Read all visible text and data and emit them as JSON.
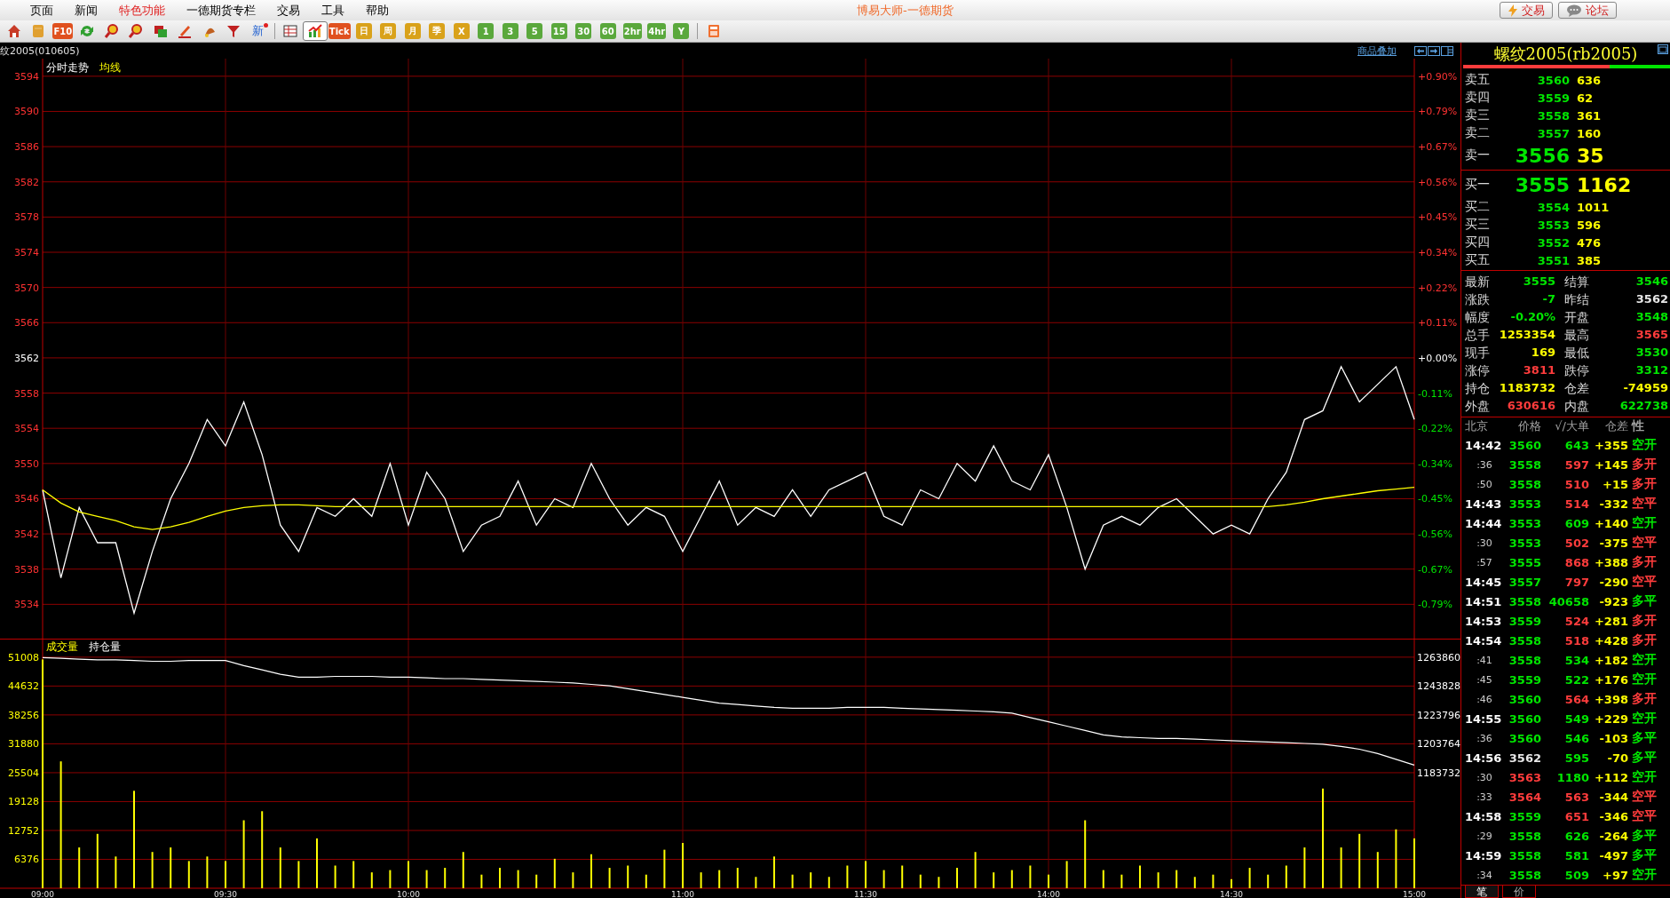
{
  "menu": [
    {
      "label": "页面",
      "highlighted": false
    },
    {
      "label": "新闻",
      "highlighted": false
    },
    {
      "label": "特色功能",
      "highlighted": true
    },
    {
      "label": "一德期货专栏",
      "highlighted": false
    },
    {
      "label": "交易",
      "highlighted": false
    },
    {
      "label": "工具",
      "highlighted": false
    },
    {
      "label": "帮助",
      "highlighted": false
    }
  ],
  "window_title": "博易大师-一德期货",
  "top_buttons": [
    {
      "kind": "lightning",
      "label": "交易"
    },
    {
      "kind": "speech",
      "label": "论坛"
    }
  ],
  "toolbar": [
    {
      "kind": "icon",
      "selected": false
    },
    {
      "kind": "icon",
      "selected": false
    },
    {
      "kind": "badge",
      "label": "F10",
      "color": "#e0501e",
      "selected": false
    },
    {
      "kind": "icon",
      "selected": false
    },
    {
      "kind": "icon",
      "selected": false
    },
    {
      "kind": "icon",
      "selected": false
    },
    {
      "kind": "icon",
      "selected": false
    },
    {
      "kind": "icon",
      "selected": false
    },
    {
      "kind": "icon",
      "selected": false
    },
    {
      "kind": "icon",
      "selected": false
    },
    {
      "kind": "text",
      "label": "新",
      "selected": false
    },
    {
      "kind": "separator"
    },
    {
      "kind": "icon",
      "selected": false
    },
    {
      "kind": "icon",
      "selected": true
    },
    {
      "kind": "badge",
      "label": "Tick",
      "color": "#e0501e",
      "selected": false
    },
    {
      "kind": "badge",
      "label": "日",
      "color": "#d9a21a",
      "selected": false
    },
    {
      "kind": "badge",
      "label": "周",
      "color": "#d9a21a",
      "selected": false
    },
    {
      "kind": "badge",
      "label": "月",
      "color": "#d9a21a",
      "selected": false
    },
    {
      "kind": "badge",
      "label": "季",
      "color": "#d9a21a",
      "selected": false
    },
    {
      "kind": "badge",
      "label": "X",
      "color": "#d9a21a",
      "selected": false
    },
    {
      "kind": "badge",
      "label": "1",
      "color": "#5aa83c",
      "selected": false
    },
    {
      "kind": "badge",
      "label": "3",
      "color": "#5aa83c",
      "selected": false
    },
    {
      "kind": "badge",
      "label": "5",
      "color": "#5aa83c",
      "selected": false
    },
    {
      "kind": "badge",
      "label": "15",
      "color": "#5aa83c",
      "selected": false
    },
    {
      "kind": "badge",
      "label": "30",
      "color": "#5aa83c",
      "selected": false
    },
    {
      "kind": "badge",
      "label": "60",
      "color": "#5aa83c",
      "selected": false
    },
    {
      "kind": "badge",
      "label": "2hr",
      "color": "#5aa83c",
      "selected": false
    },
    {
      "kind": "badge",
      "label": "4hr",
      "color": "#5aa83c",
      "selected": false
    },
    {
      "kind": "badge",
      "label": "Y",
      "color": "#5aa83c",
      "selected": false
    },
    {
      "kind": "separator"
    },
    {
      "kind": "icon",
      "selected": false
    }
  ],
  "instrument_code": "纹2005(010605)",
  "overlay_link": "商品叠加",
  "price_chart": {
    "pct_labels": [
      {
        "label": "+0.90%",
        "color": "#ff3232"
      },
      {
        "label": "+0.79%",
        "color": "#ff3232"
      },
      {
        "label": "+0.67%",
        "color": "#ff3232"
      },
      {
        "label": "+0.56%",
        "color": "#ff3232"
      },
      {
        "label": "+0.45%",
        "color": "#ff3232"
      },
      {
        "label": "+0.34%",
        "color": "#ff3232"
      },
      {
        "label": "+0.22%",
        "color": "#ff3232"
      },
      {
        "label": "+0.11%",
        "color": "#ff3232"
      },
      {
        "label": "+0.00%",
        "color": "#ffffff"
      },
      {
        "label": "-0.11%",
        "color": "#00e600"
      },
      {
        "label": "-0.22%",
        "color": "#00e600"
      },
      {
        "label": "-0.34%",
        "color": "#00e600"
      },
      {
        "label": "-0.45%",
        "color": "#00e600"
      },
      {
        "label": "-0.56%",
        "color": "#00e600"
      },
      {
        "label": "-0.67%",
        "color": "#00e600"
      },
      {
        "label": "-0.79%",
        "color": "#00e600"
      }
    ],
    "chart_data": {
      "type": "line",
      "grid": true,
      "ylim": [
        3530,
        3596
      ],
      "yticks": [
        3594,
        3590,
        3586,
        3582,
        3578,
        3574,
        3570,
        3566,
        3562,
        3558,
        3554,
        3550,
        3546,
        3542,
        3538,
        3534
      ],
      "series": [
        {
          "name": "分时走势",
          "color": "#ffffff",
          "values": [
            3547,
            3537,
            3545,
            3541,
            3541,
            3533,
            3540,
            3546,
            3550,
            3555,
            3552,
            3557,
            3551,
            3543,
            3540,
            3545,
            3544,
            3546,
            3544,
            3550,
            3543,
            3549,
            3546,
            3540,
            3543,
            3544,
            3548,
            3543,
            3546,
            3545,
            3550,
            3546,
            3543,
            3545,
            3544,
            3540,
            3544,
            3548,
            3543,
            3545,
            3544,
            3547,
            3544,
            3547,
            3548,
            3549,
            3544,
            3543,
            3547,
            3546,
            3550,
            3548,
            3552,
            3548,
            3547,
            3551,
            3545,
            3538,
            3543,
            3544,
            3543,
            3545,
            3546,
            3544,
            3542,
            3543,
            3542,
            3546,
            3549,
            3555,
            3556,
            3561,
            3557,
            3559,
            3561,
            3555
          ]
        },
        {
          "name": "均线",
          "color": "#ffff00",
          "values": [
            3547,
            3545.5,
            3544.5,
            3544,
            3543.5,
            3542.8,
            3542.5,
            3542.8,
            3543.3,
            3544,
            3544.6,
            3545,
            3545.2,
            3545.3,
            3545.3,
            3545.2,
            3545.1,
            3545.1,
            3545.1,
            3545.1,
            3545.1,
            3545.1,
            3545.1,
            3545.1,
            3545.1,
            3545.1,
            3545.1,
            3545.1,
            3545.1,
            3545.1,
            3545.1,
            3545.1,
            3545.1,
            3545.1,
            3545.1,
            3545.1,
            3545.1,
            3545.1,
            3545.1,
            3545.1,
            3545.1,
            3545.1,
            3545.1,
            3545.1,
            3545.1,
            3545.1,
            3545.1,
            3545.1,
            3545.1,
            3545.1,
            3545.1,
            3545.1,
            3545.1,
            3545.1,
            3545.1,
            3545.1,
            3545.1,
            3545.1,
            3545.1,
            3545.1,
            3545.1,
            3545.1,
            3545.1,
            3545.1,
            3545.1,
            3545.1,
            3545.1,
            3545.1,
            3545.3,
            3545.6,
            3546,
            3546.3,
            3546.6,
            3546.9,
            3547.1,
            3547.3
          ]
        }
      ]
    }
  },
  "volume_chart": {
    "chart_data": {
      "type": "bar",
      "grid": true,
      "ylim": [
        0,
        54900
      ],
      "yticks": [
        51008,
        44632,
        38256,
        31880,
        25504,
        19128,
        12752,
        6376
      ],
      "categories": [
        "09:00",
        null,
        null,
        null,
        null,
        null,
        null,
        null,
        null,
        null,
        "09:30",
        null,
        null,
        null,
        null,
        null,
        null,
        null,
        null,
        null,
        "10:00",
        null,
        null,
        null,
        null,
        null,
        null,
        null,
        null,
        null,
        null,
        null,
        null,
        null,
        null,
        "11:00",
        null,
        null,
        null,
        null,
        null,
        null,
        null,
        null,
        null,
        "11:30",
        null,
        null,
        null,
        null,
        null,
        null,
        null,
        null,
        null,
        "14:00",
        null,
        null,
        null,
        null,
        null,
        null,
        null,
        null,
        null,
        "14:30",
        null,
        null,
        null,
        null,
        null,
        null,
        null,
        null,
        null,
        "15:00"
      ],
      "series": [
        {
          "name": "成交量",
          "color": "#ffff00",
          "values": [
            50500,
            28000,
            9000,
            12000,
            7000,
            21500,
            8000,
            9000,
            6000,
            7000,
            6000,
            15000,
            17000,
            9000,
            6000,
            11000,
            5000,
            6000,
            3500,
            4000,
            6000,
            4000,
            4500,
            8000,
            3000,
            4500,
            4000,
            3000,
            6500,
            3500,
            7500,
            4500,
            5000,
            3000,
            8500,
            10000,
            3500,
            4000,
            4500,
            2500,
            7000,
            3000,
            3500,
            2500,
            5000,
            6000,
            4000,
            5000,
            3000,
            2500,
            4500,
            8000,
            3500,
            4000,
            5000,
            3000,
            6000,
            15000,
            4000,
            3000,
            5000,
            3500,
            4000,
            2500,
            3000,
            2000,
            4500,
            3000,
            5000,
            9000,
            22000,
            9000,
            12000,
            8000,
            13000,
            11000
          ]
        }
      ]
    }
  },
  "open_interest_chart": {
    "chart_data": {
      "type": "line",
      "ylim": [
        1183732,
        1263860
      ],
      "yticks": [
        1263860,
        1243828,
        1223796,
        1203764,
        1183732
      ],
      "series": [
        {
          "name": "持仓量",
          "color": "#ffffff",
          "values": [
            1263500,
            1263000,
            1262500,
            1262000,
            1262000,
            1261500,
            1261000,
            1261000,
            1261500,
            1261500,
            1261500,
            1258000,
            1255000,
            1252000,
            1250000,
            1250000,
            1250500,
            1250500,
            1250500,
            1250000,
            1250000,
            1249500,
            1249000,
            1249000,
            1248500,
            1248000,
            1247500,
            1247000,
            1246500,
            1246000,
            1245000,
            1244000,
            1242000,
            1240000,
            1238000,
            1236000,
            1234000,
            1232000,
            1231000,
            1230000,
            1229000,
            1228500,
            1228500,
            1228500,
            1229000,
            1229000,
            1229000,
            1228500,
            1228000,
            1227500,
            1227000,
            1226500,
            1226000,
            1225000,
            1222000,
            1219000,
            1216000,
            1213000,
            1210000,
            1208500,
            1208000,
            1207500,
            1207500,
            1207000,
            1206500,
            1206000,
            1205500,
            1205000,
            1204500,
            1204000,
            1203500,
            1202000,
            1200000,
            1197000,
            1193000,
            1189000
          ]
        }
      ]
    }
  },
  "quote": {
    "title": "螺纹2005(rb2005)",
    "ratio_bar": {
      "level": 0.71
    },
    "asks": [
      {
        "label": "卖五",
        "price": "3560",
        "volume": "636",
        "best": false
      },
      {
        "label": "卖四",
        "price": "3559",
        "volume": "62",
        "best": false
      },
      {
        "label": "卖三",
        "price": "3558",
        "volume": "361",
        "best": false
      },
      {
        "label": "卖二",
        "price": "3557",
        "volume": "160",
        "best": false
      },
      {
        "label": "卖一",
        "price": "3556",
        "volume": "35",
        "best": true
      }
    ],
    "bids": [
      {
        "label": "买一",
        "price": "3555",
        "volume": "1162",
        "best": true
      },
      {
        "label": "买二",
        "price": "3554",
        "volume": "1011",
        "best": false
      },
      {
        "label": "买三",
        "price": "3553",
        "volume": "596",
        "best": false
      },
      {
        "label": "买四",
        "price": "3552",
        "volume": "476",
        "best": false
      },
      {
        "label": "买五",
        "price": "3551",
        "volume": "385",
        "best": false
      }
    ],
    "stats": [
      {
        "label": "最新",
        "value": "3555",
        "color": "#00e600"
      },
      {
        "label": "结算",
        "value": "3546",
        "color": "#00e600"
      },
      {
        "label": "涨跌",
        "value": "-7",
        "color": "#00e600"
      },
      {
        "label": "昨结",
        "value": "3562",
        "color": "#e6e6e6"
      },
      {
        "label": "幅度",
        "value": "-0.20%",
        "color": "#00e600"
      },
      {
        "label": "开盘",
        "value": "3548",
        "color": "#00e600"
      },
      {
        "label": "总手",
        "value": "1253354",
        "color": "#ffff00"
      },
      {
        "label": "最高",
        "value": "3565",
        "color": "#ff3c3c"
      },
      {
        "label": "现手",
        "value": "169",
        "color": "#ffff00"
      },
      {
        "label": "最低",
        "value": "3530",
        "color": "#00e600"
      },
      {
        "label": "涨停",
        "value": "3811",
        "color": "#ff3c3c"
      },
      {
        "label": "跌停",
        "value": "3312",
        "color": "#00e600"
      },
      {
        "label": "持仓",
        "value": "1183732",
        "color": "#ffff00"
      },
      {
        "label": "仓差",
        "value": "-74959",
        "color": "#ffff00"
      },
      {
        "label": "外盘",
        "value": "630616",
        "color": "#ff3c3c"
      },
      {
        "label": "内盘",
        "value": "622738",
        "color": "#00e600"
      }
    ]
  },
  "trades": {
    "columns": [
      "北京",
      "价格",
      "√/大单",
      "仓差",
      "性"
    ],
    "rows": [
      {
        "kind": "minute",
        "time": "14:42",
        "price": {
          "text": "3560",
          "color": "#00e600"
        },
        "volume": {
          "text": "643",
          "color": "#00e600"
        },
        "oi_change": "+355",
        "nature": {
          "text": "空开",
          "color": "#00e600"
        }
      },
      {
        "kind": "second",
        "time": ":36",
        "price": {
          "text": "3558",
          "color": "#00e600"
        },
        "volume": {
          "text": "597",
          "color": "#ff3c3c"
        },
        "oi_change": "+145",
        "nature": {
          "text": "多开",
          "color": "#ff3c3c"
        }
      },
      {
        "kind": "second",
        "time": ":50",
        "price": {
          "text": "3558",
          "color": "#00e600"
        },
        "volume": {
          "text": "510",
          "color": "#ff3c3c"
        },
        "oi_change": "+15",
        "nature": {
          "text": "多开",
          "color": "#ff3c3c"
        }
      },
      {
        "kind": "minute",
        "time": "14:43",
        "price": {
          "text": "3553",
          "color": "#00e600"
        },
        "volume": {
          "text": "514",
          "color": "#ff3c3c"
        },
        "oi_change": "-332",
        "nature": {
          "text": "空平",
          "color": "#ff3c3c"
        }
      },
      {
        "kind": "minute",
        "time": "14:44",
        "price": {
          "text": "3553",
          "color": "#00e600"
        },
        "volume": {
          "text": "609",
          "color": "#00e600"
        },
        "oi_change": "+140",
        "nature": {
          "text": "空开",
          "color": "#00e600"
        }
      },
      {
        "kind": "second",
        "time": ":30",
        "price": {
          "text": "3553",
          "color": "#00e600"
        },
        "volume": {
          "text": "502",
          "color": "#ff3c3c"
        },
        "oi_change": "-375",
        "nature": {
          "text": "空平",
          "color": "#ff3c3c"
        }
      },
      {
        "kind": "second",
        "time": ":57",
        "price": {
          "text": "3555",
          "color": "#00e600"
        },
        "volume": {
          "text": "868",
          "color": "#ff3c3c"
        },
        "oi_change": "+388",
        "nature": {
          "text": "多开",
          "color": "#ff3c3c"
        }
      },
      {
        "kind": "minute",
        "time": "14:45",
        "price": {
          "text": "3557",
          "color": "#00e600"
        },
        "volume": {
          "text": "797",
          "color": "#ff3c3c"
        },
        "oi_change": "-290",
        "nature": {
          "text": "空平",
          "color": "#ff3c3c"
        }
      },
      {
        "kind": "minute",
        "time": "14:51",
        "price": {
          "text": "3558",
          "color": "#00e600"
        },
        "volume": {
          "text": "40658",
          "color": "#00e600"
        },
        "oi_change": "-923",
        "nature": {
          "text": "多平",
          "color": "#00e600"
        }
      },
      {
        "kind": "minute",
        "time": "14:53",
        "price": {
          "text": "3559",
          "color": "#00e600"
        },
        "volume": {
          "text": "524",
          "color": "#ff3c3c"
        },
        "oi_change": "+281",
        "nature": {
          "text": "多开",
          "color": "#ff3c3c"
        }
      },
      {
        "kind": "minute",
        "time": "14:54",
        "price": {
          "text": "3558",
          "color": "#00e600"
        },
        "volume": {
          "text": "518",
          "color": "#ff3c3c"
        },
        "oi_change": "+428",
        "nature": {
          "text": "多开",
          "color": "#ff3c3c"
        }
      },
      {
        "kind": "second",
        "time": ":41",
        "price": {
          "text": "3558",
          "color": "#00e600"
        },
        "volume": {
          "text": "534",
          "color": "#00e600"
        },
        "oi_change": "+182",
        "nature": {
          "text": "空开",
          "color": "#00e600"
        }
      },
      {
        "kind": "second",
        "time": ":45",
        "price": {
          "text": "3559",
          "color": "#00e600"
        },
        "volume": {
          "text": "522",
          "color": "#00e600"
        },
        "oi_change": "+176",
        "nature": {
          "text": "空开",
          "color": "#00e600"
        }
      },
      {
        "kind": "second",
        "time": ":46",
        "price": {
          "text": "3560",
          "color": "#00e600"
        },
        "volume": {
          "text": "564",
          "color": "#ff3c3c"
        },
        "oi_change": "+398",
        "nature": {
          "text": "多开",
          "color": "#ff3c3c"
        }
      },
      {
        "kind": "minute",
        "time": "14:55",
        "price": {
          "text": "3560",
          "color": "#00e600"
        },
        "volume": {
          "text": "549",
          "color": "#00e600"
        },
        "oi_change": "+229",
        "nature": {
          "text": "空开",
          "color": "#00e600"
        }
      },
      {
        "kind": "second",
        "time": ":36",
        "price": {
          "text": "3560",
          "color": "#00e600"
        },
        "volume": {
          "text": "546",
          "color": "#00e600"
        },
        "oi_change": "-103",
        "nature": {
          "text": "多平",
          "color": "#00e600"
        }
      },
      {
        "kind": "minute",
        "time": "14:56",
        "price": {
          "text": "3562",
          "color": "#e6e6e6"
        },
        "volume": {
          "text": "595",
          "color": "#00e600"
        },
        "oi_change": "-70",
        "nature": {
          "text": "多平",
          "color": "#00e600"
        }
      },
      {
        "kind": "second",
        "time": ":30",
        "price": {
          "text": "3563",
          "color": "#ff3c3c"
        },
        "volume": {
          "text": "1180",
          "color": "#00e600"
        },
        "oi_change": "+112",
        "nature": {
          "text": "空开",
          "color": "#00e600"
        }
      },
      {
        "kind": "second",
        "time": ":33",
        "price": {
          "text": "3564",
          "color": "#ff3c3c"
        },
        "volume": {
          "text": "563",
          "color": "#ff3c3c"
        },
        "oi_change": "-344",
        "nature": {
          "text": "空平",
          "color": "#ff3c3c"
        }
      },
      {
        "kind": "minute",
        "time": "14:58",
        "price": {
          "text": "3559",
          "color": "#00e600"
        },
        "volume": {
          "text": "651",
          "color": "#ff3c3c"
        },
        "oi_change": "-346",
        "nature": {
          "text": "空平",
          "color": "#ff3c3c"
        }
      },
      {
        "kind": "second",
        "time": ":29",
        "price": {
          "text": "3558",
          "color": "#00e600"
        },
        "volume": {
          "text": "626",
          "color": "#00e600"
        },
        "oi_change": "-264",
        "nature": {
          "text": "多平",
          "color": "#00e600"
        }
      },
      {
        "kind": "minute",
        "time": "14:59",
        "price": {
          "text": "3558",
          "color": "#00e600"
        },
        "volume": {
          "text": "581",
          "color": "#00e600"
        },
        "oi_change": "-497",
        "nature": {
          "text": "多平",
          "color": "#00e600"
        }
      },
      {
        "kind": "second",
        "time": ":34",
        "price": {
          "text": "3558",
          "color": "#00e600"
        },
        "volume": {
          "text": "509",
          "color": "#00e600"
        },
        "oi_change": "+97",
        "nature": {
          "text": "空开",
          "color": "#00e600"
        }
      }
    ]
  },
  "bottom_tabs": [
    {
      "label": "笔",
      "selected": true
    },
    {
      "label": "价",
      "selected": false
    }
  ]
}
